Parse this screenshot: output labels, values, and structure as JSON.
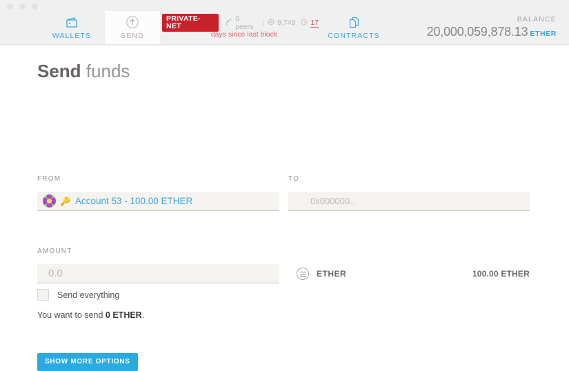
{
  "window": {
    "traffic_lights": [
      "close",
      "minimize",
      "maximize"
    ]
  },
  "nav": {
    "tabs": [
      {
        "id": "wallets",
        "label": "WALLETS",
        "icon": "wallet-icon",
        "active": false,
        "color": "#3ba4dd"
      },
      {
        "id": "send",
        "label": "SEND",
        "icon": "up-arrow-circle-icon",
        "active": true,
        "color": "#b5aaaa"
      },
      {
        "id": "contracts",
        "label": "CONTRACTS",
        "icon": "documents-icon",
        "active": false,
        "color": "#3ba4dd"
      }
    ]
  },
  "network": {
    "badge": "PRIVATE-NET",
    "badge_color": "#c8232c",
    "peers_icon": "signal-icon",
    "peers": "0 peers",
    "separator": "|",
    "block_icon": "block-icon",
    "block_number": "9,749",
    "clock_icon": "clock-icon",
    "days_count": "17",
    "days_label": "days since last block",
    "days_color": "#d9686f"
  },
  "balance": {
    "label": "BALANCE",
    "value": "20,000,059,878.13",
    "unit": "ETHER",
    "unit_color": "#3ba4dd"
  },
  "page": {
    "title_bold": "Send",
    "title_light": " funds"
  },
  "form": {
    "from": {
      "label": "FROM",
      "avatar": "account-identicon",
      "key_icon": "key-icon",
      "account_text": "Account 53 - 100.00 ETHER"
    },
    "to": {
      "label": "TO",
      "value": "",
      "placeholder": "0x000000.."
    },
    "amount": {
      "label": "AMOUNT",
      "value": "",
      "placeholder": "0.0"
    },
    "send_everything": {
      "label": "Send everything",
      "checked": false
    },
    "note_prefix": "You want to send ",
    "note_amount": "0 ETHER",
    "note_suffix": ".",
    "token_row": {
      "icon": "list-circle-icon",
      "name": "ETHER",
      "balance": "100.00 ETHER"
    },
    "more_options_button": "SHOW MORE OPTIONS"
  }
}
